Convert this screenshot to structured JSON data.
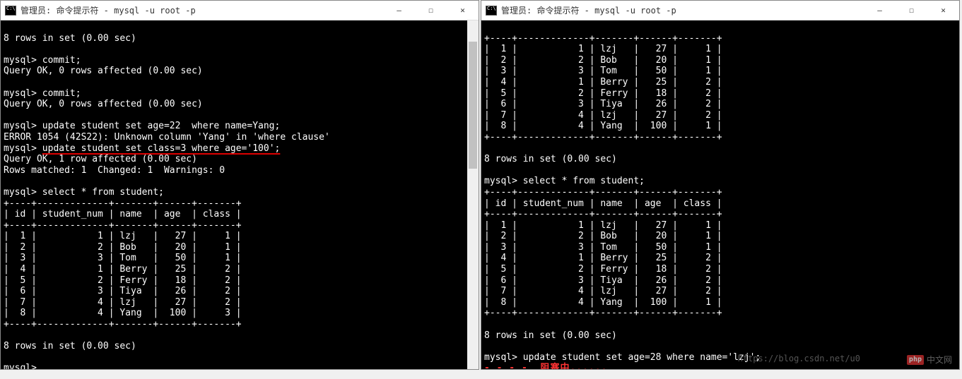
{
  "leftWindow": {
    "title": "管理员: 命令提示符 - mysql  -u root -p",
    "lines": {
      "l1": "8 rows in set (0.00 sec)",
      "l2": "",
      "l3": "mysql> commit;",
      "l4": "Query OK, 0 rows affected (0.00 sec)",
      "l5": "",
      "l6": "mysql> commit;",
      "l7": "Query OK, 0 rows affected (0.00 sec)",
      "l8": "",
      "l9": "mysql> update student set age=22  where name=Yang;",
      "l10": "ERROR 1054 (42S22): Unknown column 'Yang' in 'where clause'",
      "l11a": "mysql> ",
      "l11b": "update student set class=3 where age='100';",
      "l12": "Query OK, 1 row affected (0.00 sec)",
      "l13": "Rows matched: 1  Changed: 1  Warnings: 0",
      "l14": "",
      "l15": "mysql> select * from student;"
    },
    "tableBorder": "+----+-------------+-------+------+-------+",
    "tableHeader": "| id | student_num | name  | age  | class |",
    "tableRows": [
      "|  1 |           1 | lzj   |   27 |     1 |",
      "|  2 |           2 | Bob   |   20 |     1 |",
      "|  3 |           3 | Tom   |   50 |     1 |",
      "|  4 |           1 | Berry |   25 |     2 |",
      "|  5 |           2 | Ferry |   18 |     2 |",
      "|  6 |           3 | Tiya  |   26 |     2 |",
      "|  7 |           4 | lzj   |   27 |     2 |",
      "|  8 |           4 | Yang  |  100 |     3 |"
    ],
    "after1": "",
    "after2": "8 rows in set (0.00 sec)",
    "after3": "",
    "after4": "mysql>"
  },
  "rightWindow": {
    "title": "管理员: 命令提示符 - mysql  -u root -p",
    "topBorder": "+----+-------------+-------+------+-------+",
    "topRows": [
      "|  1 |           1 | lzj   |   27 |     1 |",
      "|  2 |           2 | Bob   |   20 |     1 |",
      "|  3 |           3 | Tom   |   50 |     1 |",
      "|  4 |           1 | Berry |   25 |     2 |",
      "|  5 |           2 | Ferry |   18 |     2 |",
      "|  6 |           3 | Tiya  |   26 |     2 |",
      "|  7 |           4 | lzj   |   27 |     2 |",
      "|  8 |           4 | Yang  |  100 |     1 |"
    ],
    "mid1": "",
    "mid2": "8 rows in set (0.00 sec)",
    "mid3": "",
    "mid4": "mysql> select * from student;",
    "tableBorder": "+----+-------------+-------+------+-------+",
    "tableHeader": "| id | student_num | name  | age  | class |",
    "tableRows": [
      "|  1 |           1 | lzj   |   27 |     1 |",
      "|  2 |           2 | Bob   |   20 |     1 |",
      "|  3 |           3 | Tom   |   50 |     1 |",
      "|  4 |           1 | Berry |   25 |     2 |",
      "|  5 |           2 | Ferry |   18 |     2 |",
      "|  6 |           3 | Tiya  |   26 |     2 |",
      "|  7 |           4 | lzj   |   27 |     2 |",
      "|  8 |           4 | Yang  |  100 |     1 |"
    ],
    "after1": "",
    "after2": "8 rows in set (0.00 sec)",
    "after3": "",
    "after4": "mysql> update student set age=28 where name='lzj';",
    "annotPrefix": "- - - -  ",
    "annot": "阻塞中......"
  },
  "watermark": {
    "badge": "php",
    "text": "中文网"
  },
  "faintUrl": "https://blog.csdn.net/u0",
  "winbtns": {
    "min": "—",
    "max": "☐",
    "close": "✕"
  }
}
